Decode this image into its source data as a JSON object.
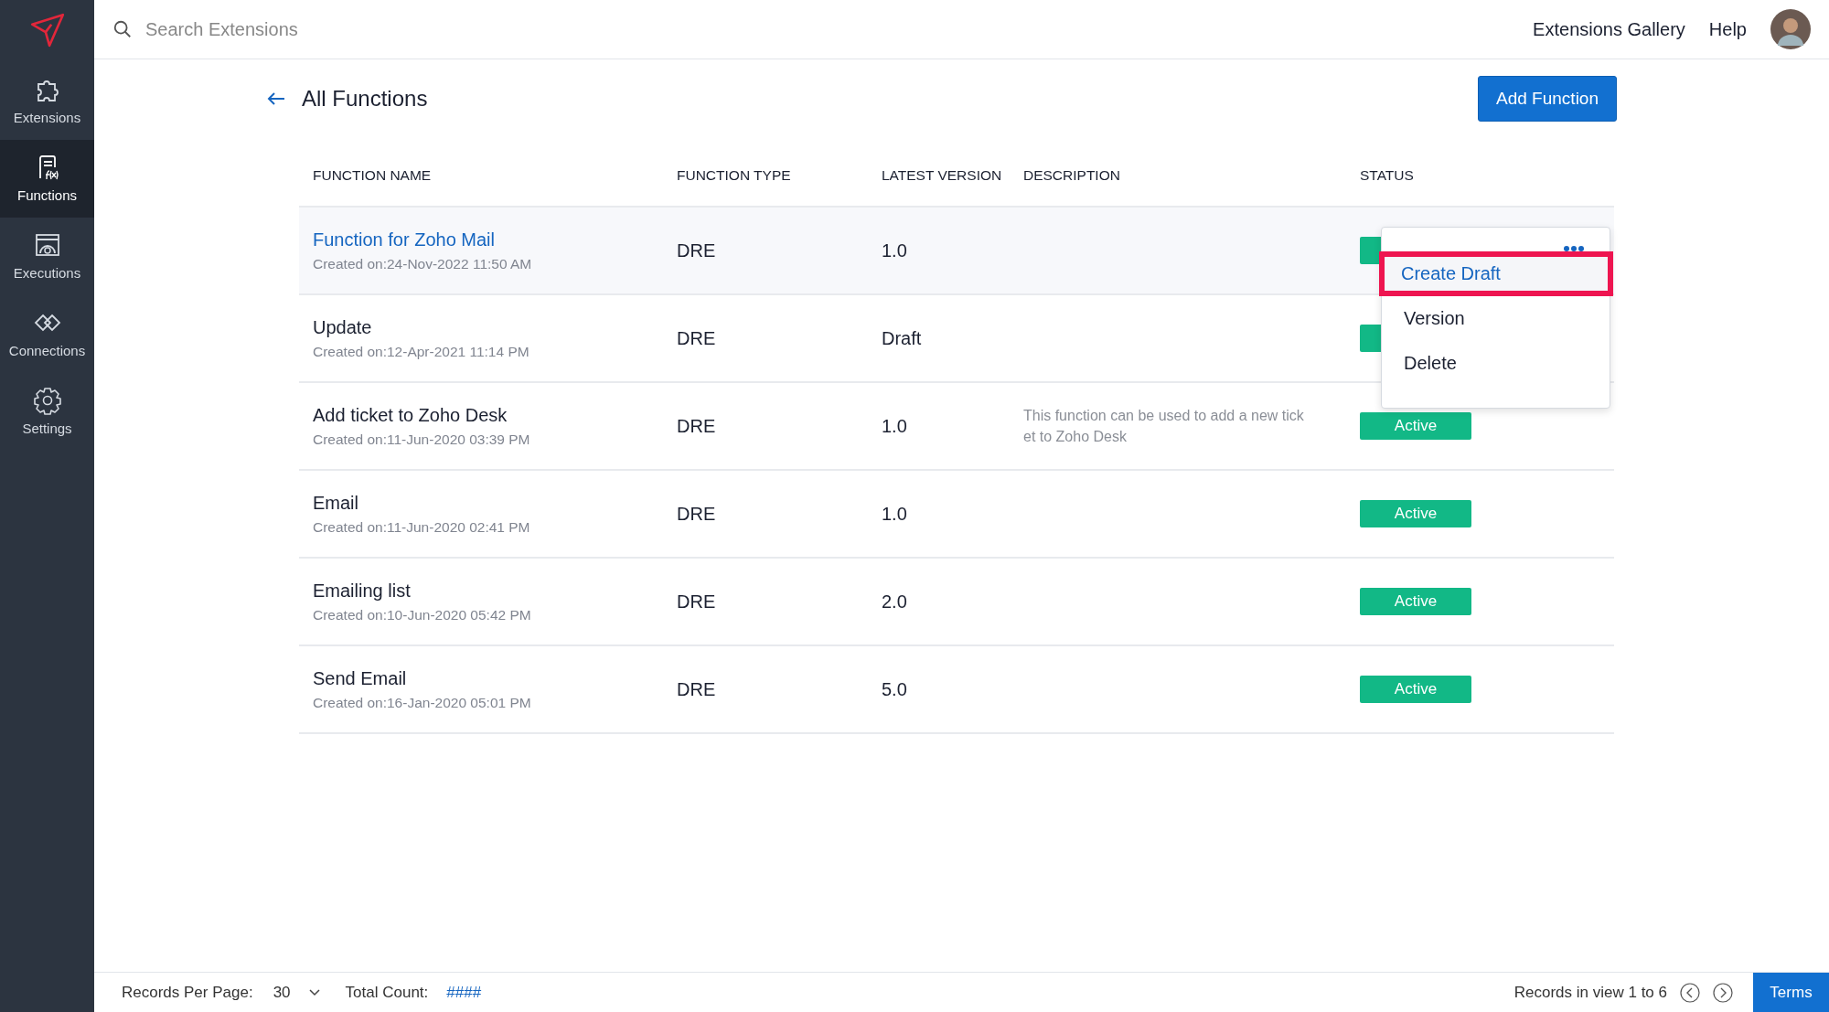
{
  "sidebar": {
    "items": [
      {
        "label": "Extensions",
        "kind": "puzzle",
        "selected": false
      },
      {
        "label": "Functions",
        "kind": "function",
        "selected": true
      },
      {
        "label": "Executions",
        "kind": "executions",
        "selected": false
      },
      {
        "label": "Connections",
        "kind": "connections",
        "selected": false
      },
      {
        "label": "Settings",
        "kind": "settings",
        "selected": false
      }
    ]
  },
  "search": {
    "placeholder": "Search Extensions"
  },
  "top_links": [
    "Extensions Gallery",
    "Help"
  ],
  "page": {
    "title": "All Functions",
    "add_button": "Add Function"
  },
  "table": {
    "columns": [
      "FUNCTION NAME",
      "FUNCTION TYPE",
      "LATEST VERSION",
      "DESCRIPTION",
      "STATUS"
    ],
    "rows": [
      {
        "name": "Function for Zoho Mail",
        "created": "Created on:24-Nov-2022 11:50 AM",
        "type": "DRE",
        "version": "1.0",
        "selected": true
      },
      {
        "name": "Update",
        "created": "Created on:12-Apr-2021 11:14 PM",
        "type": "DRE",
        "version": "Draft",
        "selected": false
      },
      {
        "name": "Add ticket to Zoho Desk",
        "created": "Created on:11-Jun-2020 03:39 PM",
        "type": "DRE",
        "version": "1.0",
        "description_lines": [
          "This function can be used to add a new tick",
          "et to Zoho Desk"
        ],
        "status": "Active",
        "selected": false
      },
      {
        "name": "Email",
        "created": "Created on:11-Jun-2020 02:41 PM",
        "type": "DRE",
        "version": "1.0",
        "status": "Active",
        "selected": false
      },
      {
        "name": "Emailing list",
        "created": "Created on:10-Jun-2020 05:42 PM",
        "type": "DRE",
        "version": "2.0",
        "status": "Active",
        "selected": false
      },
      {
        "name": "Send Email",
        "created": "Created on:16-Jan-2020 05:01 PM",
        "type": "DRE",
        "version": "5.0",
        "status": "Active",
        "selected": false
      }
    ]
  },
  "menu": {
    "items": [
      {
        "label": "Create Draft",
        "selected": true
      },
      {
        "label": "Version",
        "selected": false
      },
      {
        "label": "Delete",
        "selected": false
      }
    ]
  },
  "footer": {
    "per_page_label": "Records Per Page:",
    "per_page": "30",
    "total_label": "Total Count:",
    "total": "####",
    "records_in_view": "Records in view 1 to 6",
    "terms": "Terms"
  }
}
